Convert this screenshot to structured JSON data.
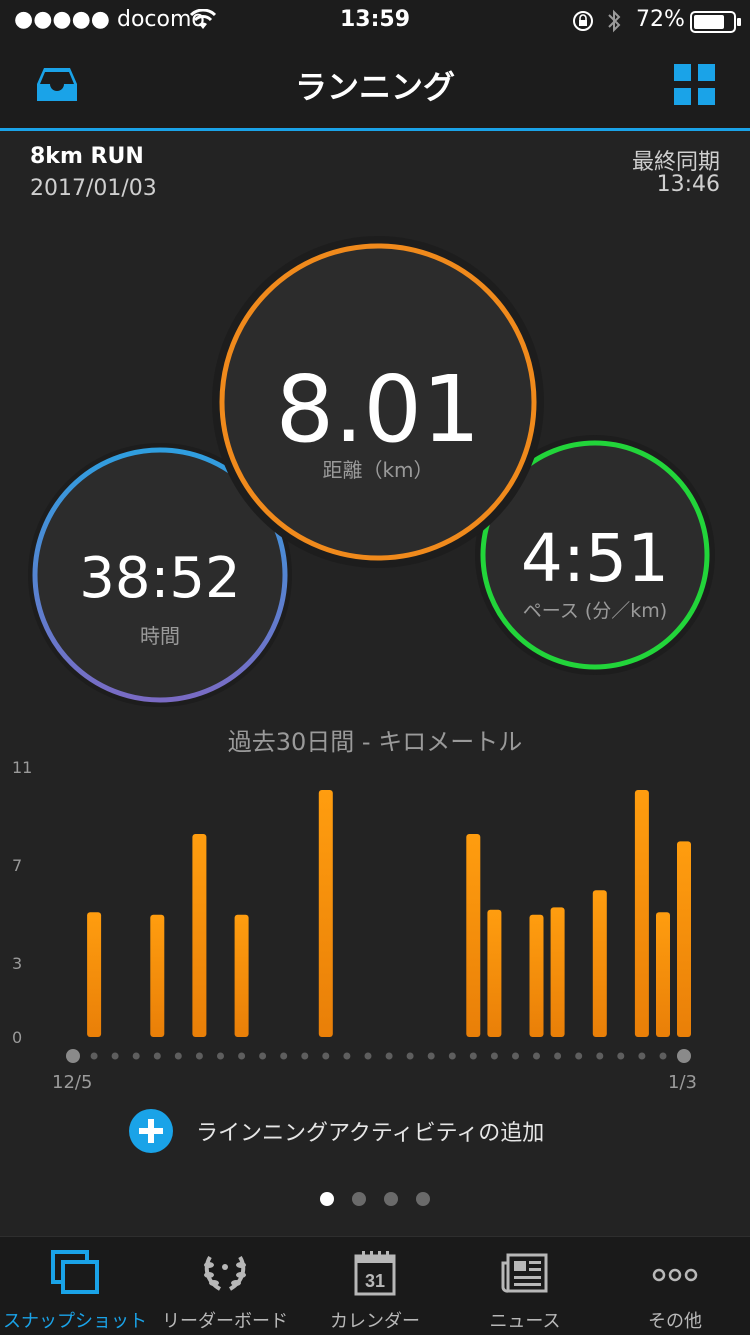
{
  "status_bar": {
    "carrier": "●●●●● docomo",
    "time": "13:59",
    "battery": "72%"
  },
  "header": {
    "title": "ランニング"
  },
  "summary": {
    "workout_name": "8km RUN",
    "date": "2017/01/03",
    "last_sync_label": "最終同期",
    "last_sync_time": "13:46"
  },
  "metrics": {
    "distance": {
      "value": "8.01",
      "label": "距離（km）"
    },
    "time": {
      "value": "38:52",
      "label": "時間"
    },
    "pace": {
      "value": "4:51",
      "label": "ペース (分／km)"
    }
  },
  "colors": {
    "accent": "#1aa3e8",
    "bar": "#f5900c",
    "distance_ring": "#f08a1c",
    "time_ring": "#3a8fdc",
    "pace_ring": "#22d53a"
  },
  "chart_data": {
    "type": "bar",
    "title": "過去30日間 - キロメートル",
    "y_ticks": [
      "11",
      "7",
      "3",
      "0"
    ],
    "ylim": [
      0,
      11
    ],
    "x_start_label": "12/5",
    "x_end_label": "1/3",
    "days": 30,
    "values": [
      0,
      5.1,
      0,
      0,
      5.0,
      0,
      8.3,
      0,
      5.0,
      0,
      0,
      0,
      10.1,
      0,
      0,
      0,
      0,
      0,
      0,
      8.3,
      5.2,
      0,
      5.0,
      5.3,
      0,
      6.0,
      0,
      10.1,
      5.1,
      8.0
    ]
  },
  "add_activity": {
    "label": "ラインニングアクティビティの追加"
  },
  "pager": {
    "count": 4,
    "active": 0
  },
  "tabs": [
    {
      "label": "スナップショット",
      "icon": "snapshot-icon",
      "active": true
    },
    {
      "label": "リーダーボード",
      "icon": "laurel-icon",
      "active": false
    },
    {
      "label": "カレンダー",
      "icon": "calendar-icon",
      "active": false,
      "day": "31"
    },
    {
      "label": "ニュース",
      "icon": "newspaper-icon",
      "active": false
    },
    {
      "label": "その他",
      "icon": "more-icon",
      "active": false
    }
  ]
}
